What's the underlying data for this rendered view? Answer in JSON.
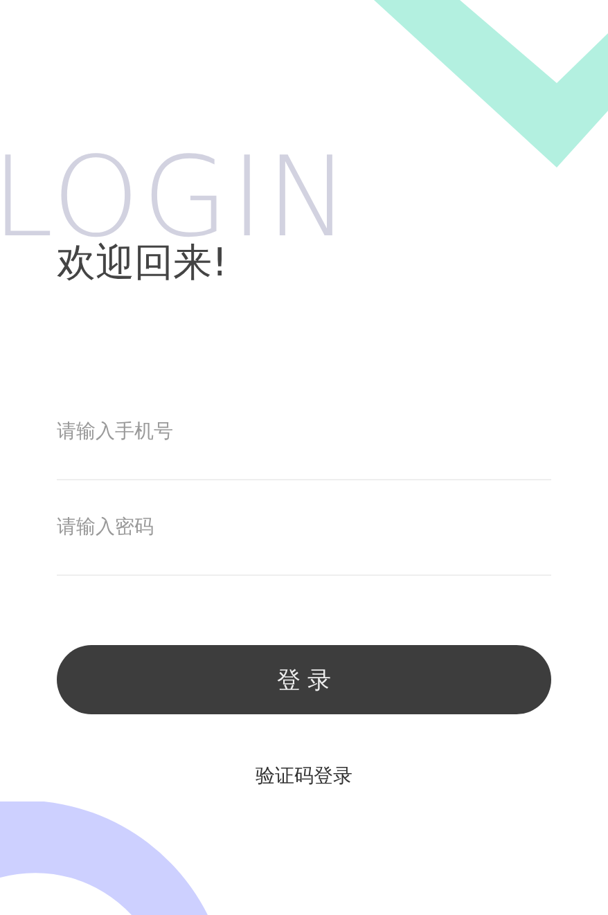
{
  "watermark": "LOGIN",
  "title": "欢迎回来!",
  "fields": [
    {
      "placeholder": "请输入手机号"
    },
    {
      "placeholder": "请输入密码"
    }
  ],
  "login_button": "登 录",
  "alt_login_link": "验证码登录"
}
